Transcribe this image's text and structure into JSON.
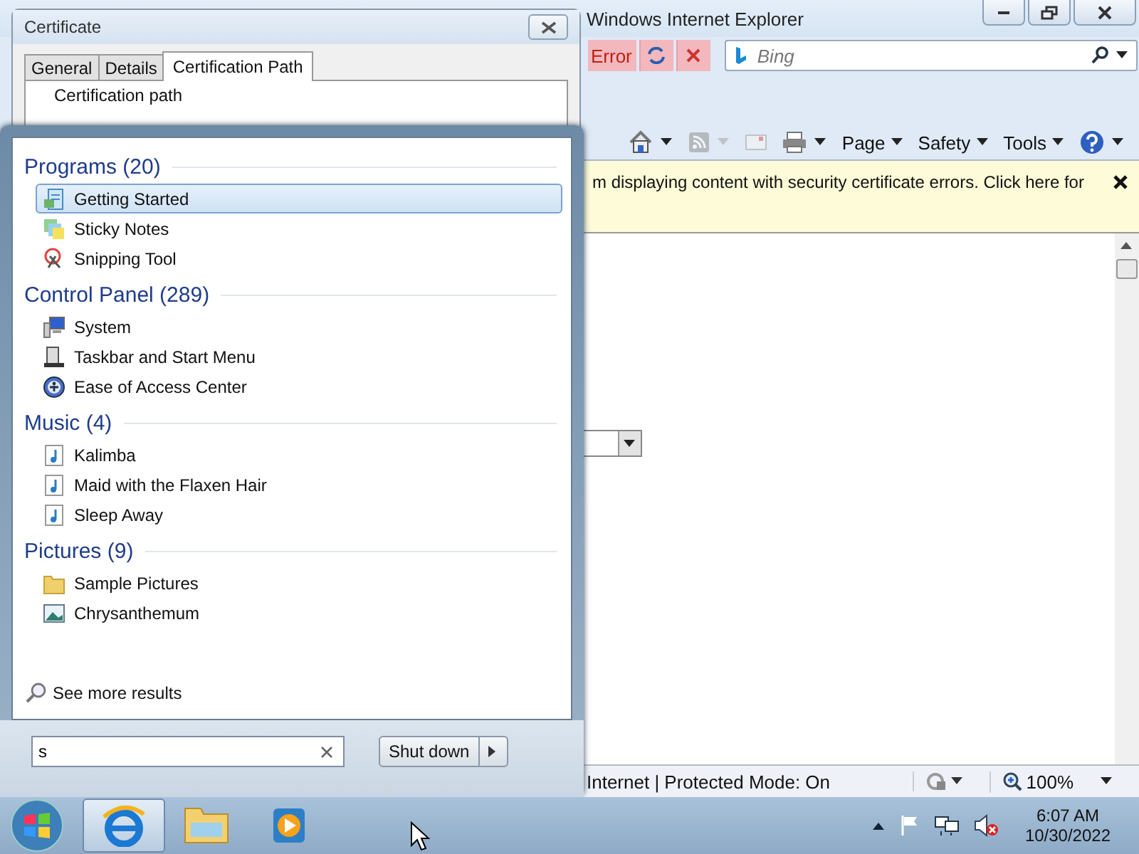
{
  "ie_window": {
    "title": "Windows Internet Explorer",
    "address_status": "Error",
    "search": {
      "placeholder": "Bing"
    },
    "command_bar": [
      {
        "kind": "home",
        "disabled": false
      },
      {
        "kind": "feeds",
        "disabled": true
      },
      {
        "kind": "mail",
        "disabled": true
      },
      {
        "kind": "print",
        "disabled": false
      },
      {
        "kind": "menu",
        "label": "Page",
        "disabled": false
      },
      {
        "kind": "menu",
        "label": "Safety",
        "disabled": false
      },
      {
        "kind": "menu",
        "label": "Tools",
        "disabled": false
      },
      {
        "kind": "help",
        "disabled": false
      }
    ],
    "info_bar": {
      "text": "m displaying content with security certificate errors. Click here for"
    },
    "status_bar": {
      "zone": "Internet | Protected Mode: On",
      "zoom": "100%"
    }
  },
  "certificate_dialog": {
    "title": "Certificate",
    "tabs": [
      {
        "label": "General",
        "selected": false
      },
      {
        "label": "Details",
        "selected": false
      },
      {
        "label": "Certification Path",
        "selected": true
      }
    ],
    "group_label": "Certification path"
  },
  "start_menu": {
    "sections": [
      {
        "heading": "Programs (20)",
        "items": [
          {
            "label": "Getting Started",
            "kind": "getting-started",
            "selected": true
          },
          {
            "label": "Sticky Notes",
            "kind": "notes",
            "selected": false
          },
          {
            "label": "Snipping Tool",
            "kind": "scissors",
            "selected": false
          }
        ]
      },
      {
        "heading": "Control Panel (289)",
        "items": [
          {
            "label": "System",
            "kind": "computer",
            "selected": false
          },
          {
            "label": "Taskbar and Start Menu",
            "kind": "taskbar",
            "selected": false
          },
          {
            "label": "Ease of Access Center",
            "kind": "ease",
            "selected": false
          }
        ]
      },
      {
        "heading": "Music (4)",
        "items": [
          {
            "label": "Kalimba",
            "kind": "music",
            "selected": false
          },
          {
            "label": "Maid with the Flaxen Hair",
            "kind": "music",
            "selected": false
          },
          {
            "label": "Sleep Away",
            "kind": "music",
            "selected": false
          }
        ]
      },
      {
        "heading": "Pictures (9)",
        "items": [
          {
            "label": "Sample Pictures",
            "kind": "folder",
            "selected": false
          },
          {
            "label": "Chrysanthemum",
            "kind": "image",
            "selected": false
          }
        ]
      }
    ],
    "see_more": "See more results",
    "search": {
      "value": "s"
    },
    "shutdown": "Shut down"
  },
  "taskbar": {
    "apps": [
      {
        "kind": "ie",
        "selected": true
      },
      {
        "kind": "explorer",
        "selected": false
      },
      {
        "kind": "media",
        "selected": false
      }
    ],
    "time": "6:07 AM",
    "date": "10/30/2022"
  }
}
